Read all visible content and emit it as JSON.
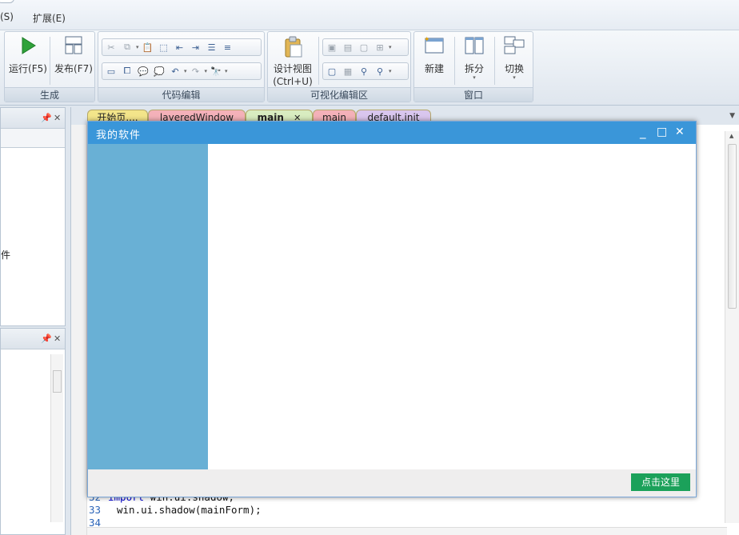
{
  "menubar": {
    "items": [
      "(S)",
      "扩展(E)"
    ]
  },
  "ribbon": {
    "groups": {
      "build": {
        "title": "生成",
        "run_label": "运行(F5)",
        "publish_label": "发布(F7)"
      },
      "code_edit": {
        "title": "代码编辑"
      },
      "visual_edit": {
        "title": "可视化编辑区",
        "design_view_label": "设计视图",
        "design_view_shortcut": "(Ctrl+U)"
      },
      "window": {
        "title": "窗口",
        "new_label": "新建",
        "split_label": "拆分",
        "switch_label": "切换"
      }
    }
  },
  "left_panel_top": {
    "visible_text": "件"
  },
  "doc_tabs": [
    {
      "label": "开始页....",
      "color": "#f3e58a"
    },
    {
      "label": "layeredWindow",
      "color": "#f4b1b9"
    },
    {
      "label": "main",
      "color": "#d8ecc0",
      "active": true
    },
    {
      "label": "main",
      "color": "#f4b1b9"
    },
    {
      "label": "default.init",
      "color": "#d9c6ee"
    }
  ],
  "code": [
    {
      "line": "32",
      "keyword": "import",
      "text": " win.ui.shadow;"
    },
    {
      "line": "33",
      "keyword": "",
      "text": "win.ui.shadow(mainForm);"
    },
    {
      "line": "34",
      "keyword": "",
      "text": ""
    }
  ],
  "window": {
    "title": "我的软件",
    "minimize": "_",
    "maximize": "□",
    "close": "✕",
    "button_label": "点击这里",
    "colors": {
      "titlebar": "#3a96d9",
      "sidebar": "#69b0d5",
      "button": "#1ba15a"
    }
  }
}
